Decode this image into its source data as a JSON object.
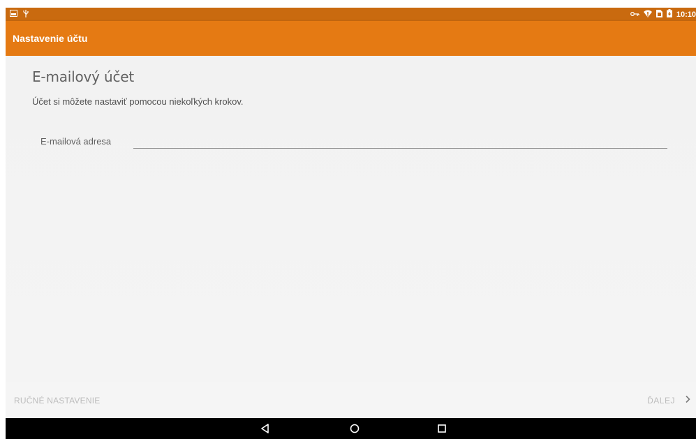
{
  "status_bar": {
    "time": "10:10",
    "icons": [
      "screenshot-icon",
      "usb-icon",
      "vpn-key-icon",
      "wifi-icon",
      "sim-icon",
      "battery-icon"
    ]
  },
  "app_bar": {
    "title": "Nastavenie účtu"
  },
  "main": {
    "heading": "E-mailový účet",
    "subtitle": "Účet si môžete nastaviť pomocou niekoľkých krokov.",
    "email_label": "E-mailová adresa",
    "email_value": "",
    "email_placeholder": ""
  },
  "footer": {
    "manual_label": "RUČNÉ NASTAVENIE",
    "next_label": "ĎALEJ"
  },
  "colors": {
    "accent": "#e57a13",
    "status_bar": "#c96a0f",
    "background": "#f2f2f2"
  }
}
